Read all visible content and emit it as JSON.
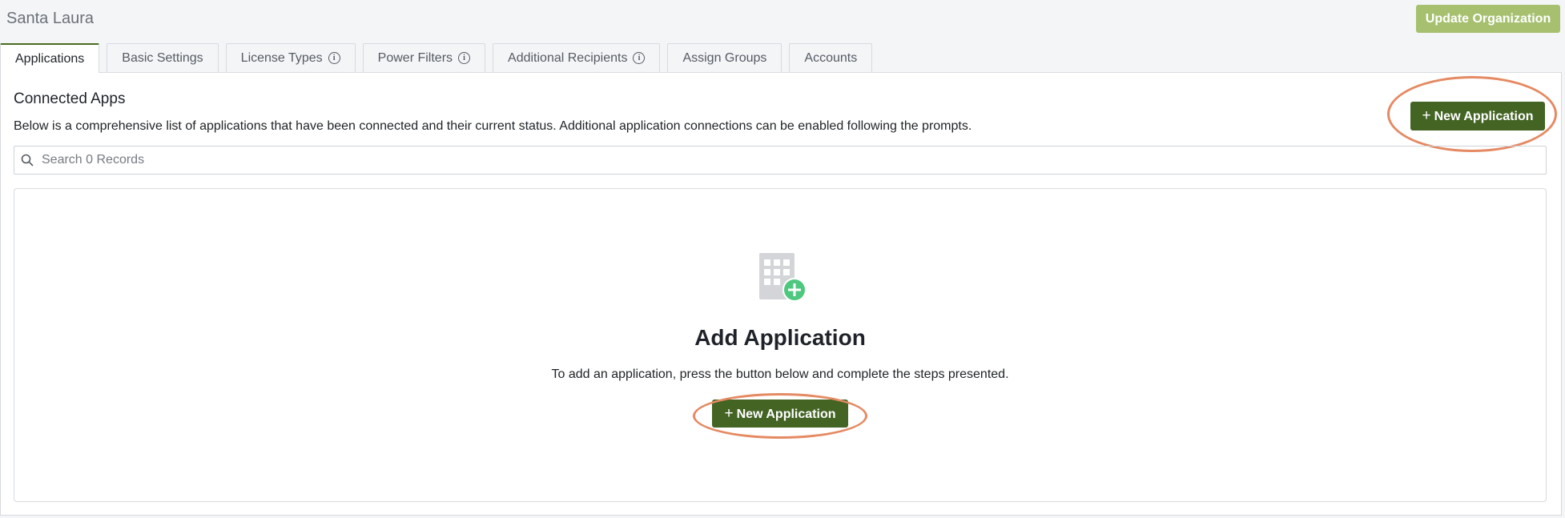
{
  "header": {
    "org_name": "Santa Laura",
    "update_button": "Update Organization"
  },
  "tabs": [
    {
      "label": "Applications",
      "active": true,
      "info": false
    },
    {
      "label": "Basic Settings",
      "active": false,
      "info": false
    },
    {
      "label": "License Types",
      "active": false,
      "info": true
    },
    {
      "label": "Power Filters",
      "active": false,
      "info": true
    },
    {
      "label": "Additional Recipients",
      "active": false,
      "info": true
    },
    {
      "label": "Assign Groups",
      "active": false,
      "info": false
    },
    {
      "label": "Accounts",
      "active": false,
      "info": false
    }
  ],
  "section": {
    "title": "Connected Apps",
    "description": "Below is a comprehensive list of applications that have been connected and their current status. Additional application connections can be enabled following the prompts.",
    "new_button_icon": "+",
    "new_button": "New Application"
  },
  "search": {
    "placeholder": "Search 0 Records",
    "value": ""
  },
  "empty_state": {
    "icon": "building-add-icon",
    "title": "Add Application",
    "description": "To add an application, press the button below and complete the steps presented.",
    "button_icon": "+",
    "button": "New Application"
  },
  "colors": {
    "primary": "#446424",
    "primary_disabled": "#a6c06f",
    "highlight": "#e58a63",
    "icon_plus": "#4ec77f"
  }
}
